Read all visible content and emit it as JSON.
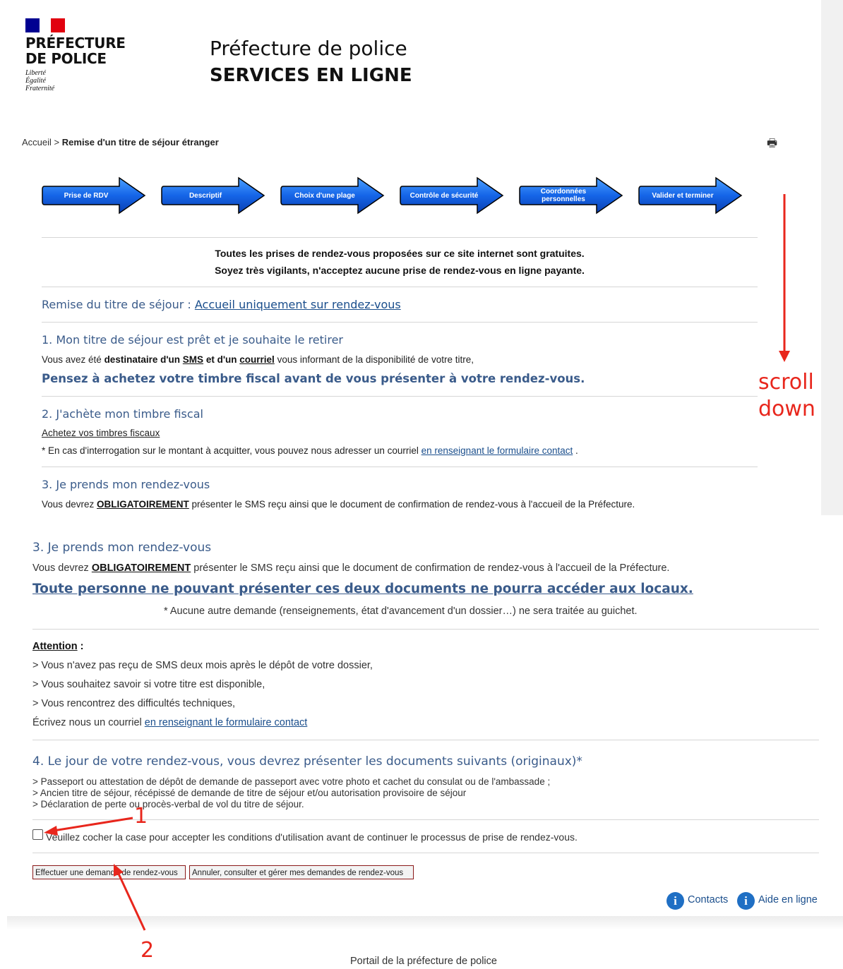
{
  "header": {
    "brand_line1": "PRÉFECTURE",
    "brand_line2": "DE POLICE",
    "motto": [
      "Liberté",
      "Égalité",
      "Fraternité"
    ],
    "title": "Préfecture de police",
    "subtitle": "SERVICES EN LIGNE"
  },
  "breadcrumb": {
    "home": "Accueil",
    "separator": ">",
    "current": "Remise d'un titre de séjour étranger"
  },
  "steps": [
    "Prise de RDV",
    "Descriptif",
    "Choix d'une plage",
    "Contrôle de sécurité",
    "Coordonnées personnelles",
    "Valider et terminer"
  ],
  "notice": {
    "line1": "Toutes les prises de rendez-vous proposées sur ce site internet sont gratuites.",
    "line2": "Soyez très vigilants, n'acceptez aucune prise de rendez-vous en ligne payante."
  },
  "remise": {
    "label": "Remise du titre de séjour :",
    "link": "Accueil uniquement sur rendez-vous"
  },
  "s1": {
    "title": "1. Mon titre de séjour est prêt et je souhaite le retirer",
    "t1": "Vous avez été ",
    "b1": "destinataire d'un ",
    "sms": "SMS",
    "b2": " et d'un ",
    "courriel": "courriel",
    "t2": " vous informant de la disponibilité de votre titre,",
    "highlight": "Pensez à achetez votre timbre fiscal avant de vous présenter à votre rendez-vous."
  },
  "s2": {
    "title": "2. J'achète mon timbre fiscal",
    "link": "Achetez vos timbres fiscaux",
    "note_prefix": "* En cas d'interrogation sur le montant à acquitter, vous pouvez nous adresser un courriel ",
    "note_link": "en renseignant le formulaire contact",
    "note_suffix": " ."
  },
  "s3": {
    "title": "3. Je prends mon rendez-vous",
    "t1": "Vous devrez ",
    "bold": "OBLIGATOIREMENT",
    "t2": " présenter le SMS reçu ainsi que le document de confirmation de rendez-vous à l'accueil de la Préfecture.",
    "warning": "Toute personne ne pouvant présenter ces deux documents ne pourra accéder aux locaux.",
    "note": "* Aucune autre demande (renseignements, état d'avancement d'un dossier…) ne sera traitée au guichet."
  },
  "attention": {
    "title": "Attention",
    "colon": " :",
    "items": [
      "> Vous n'avez pas reçu de SMS deux mois après le dépôt de votre dossier,",
      "> Vous souhaitez savoir si votre titre est disponible,",
      "> Vous rencontrez des difficultés techniques,"
    ],
    "write_prefix": "Écrivez nous un courriel ",
    "write_link": "en renseignant le formulaire contact"
  },
  "s4": {
    "title": "4. Le jour de votre rendez-vous, vous devrez présenter les documents suivants (originaux)*",
    "items": [
      "> Passeport ou attestation de dépôt de demande de passeport avec votre photo et cachet du consulat ou de l'ambassade ;",
      "> Ancien titre de séjour, récépissé de demande de titre de séjour et/ou autorisation provisoire de séjour",
      "> Déclaration de perte ou procès-verbal de vol du titre de séjour."
    ]
  },
  "checkbox": {
    "checked": false,
    "label": "Veuillez cocher la case pour accepter les conditions d'utilisation avant de continuer le processus de prise de rendez-vous."
  },
  "buttons": {
    "request": "Effectuer une demande de rendez-vous",
    "manage": "Annuler, consulter et gérer mes demandes de rendez-vous"
  },
  "links": {
    "contacts": "Contacts",
    "help": "Aide en ligne"
  },
  "footer": {
    "text": "Portail de la préfecture de police"
  },
  "annotations": {
    "scroll1": "scroll",
    "scroll2": "down",
    "n1": "1",
    "n2": "2"
  },
  "colors": {
    "accent": "#3a5b8a",
    "step_blue": "#1565e8",
    "annotation_red": "#e8261c",
    "flag_blue": "#000091",
    "flag_red": "#e1000f"
  }
}
